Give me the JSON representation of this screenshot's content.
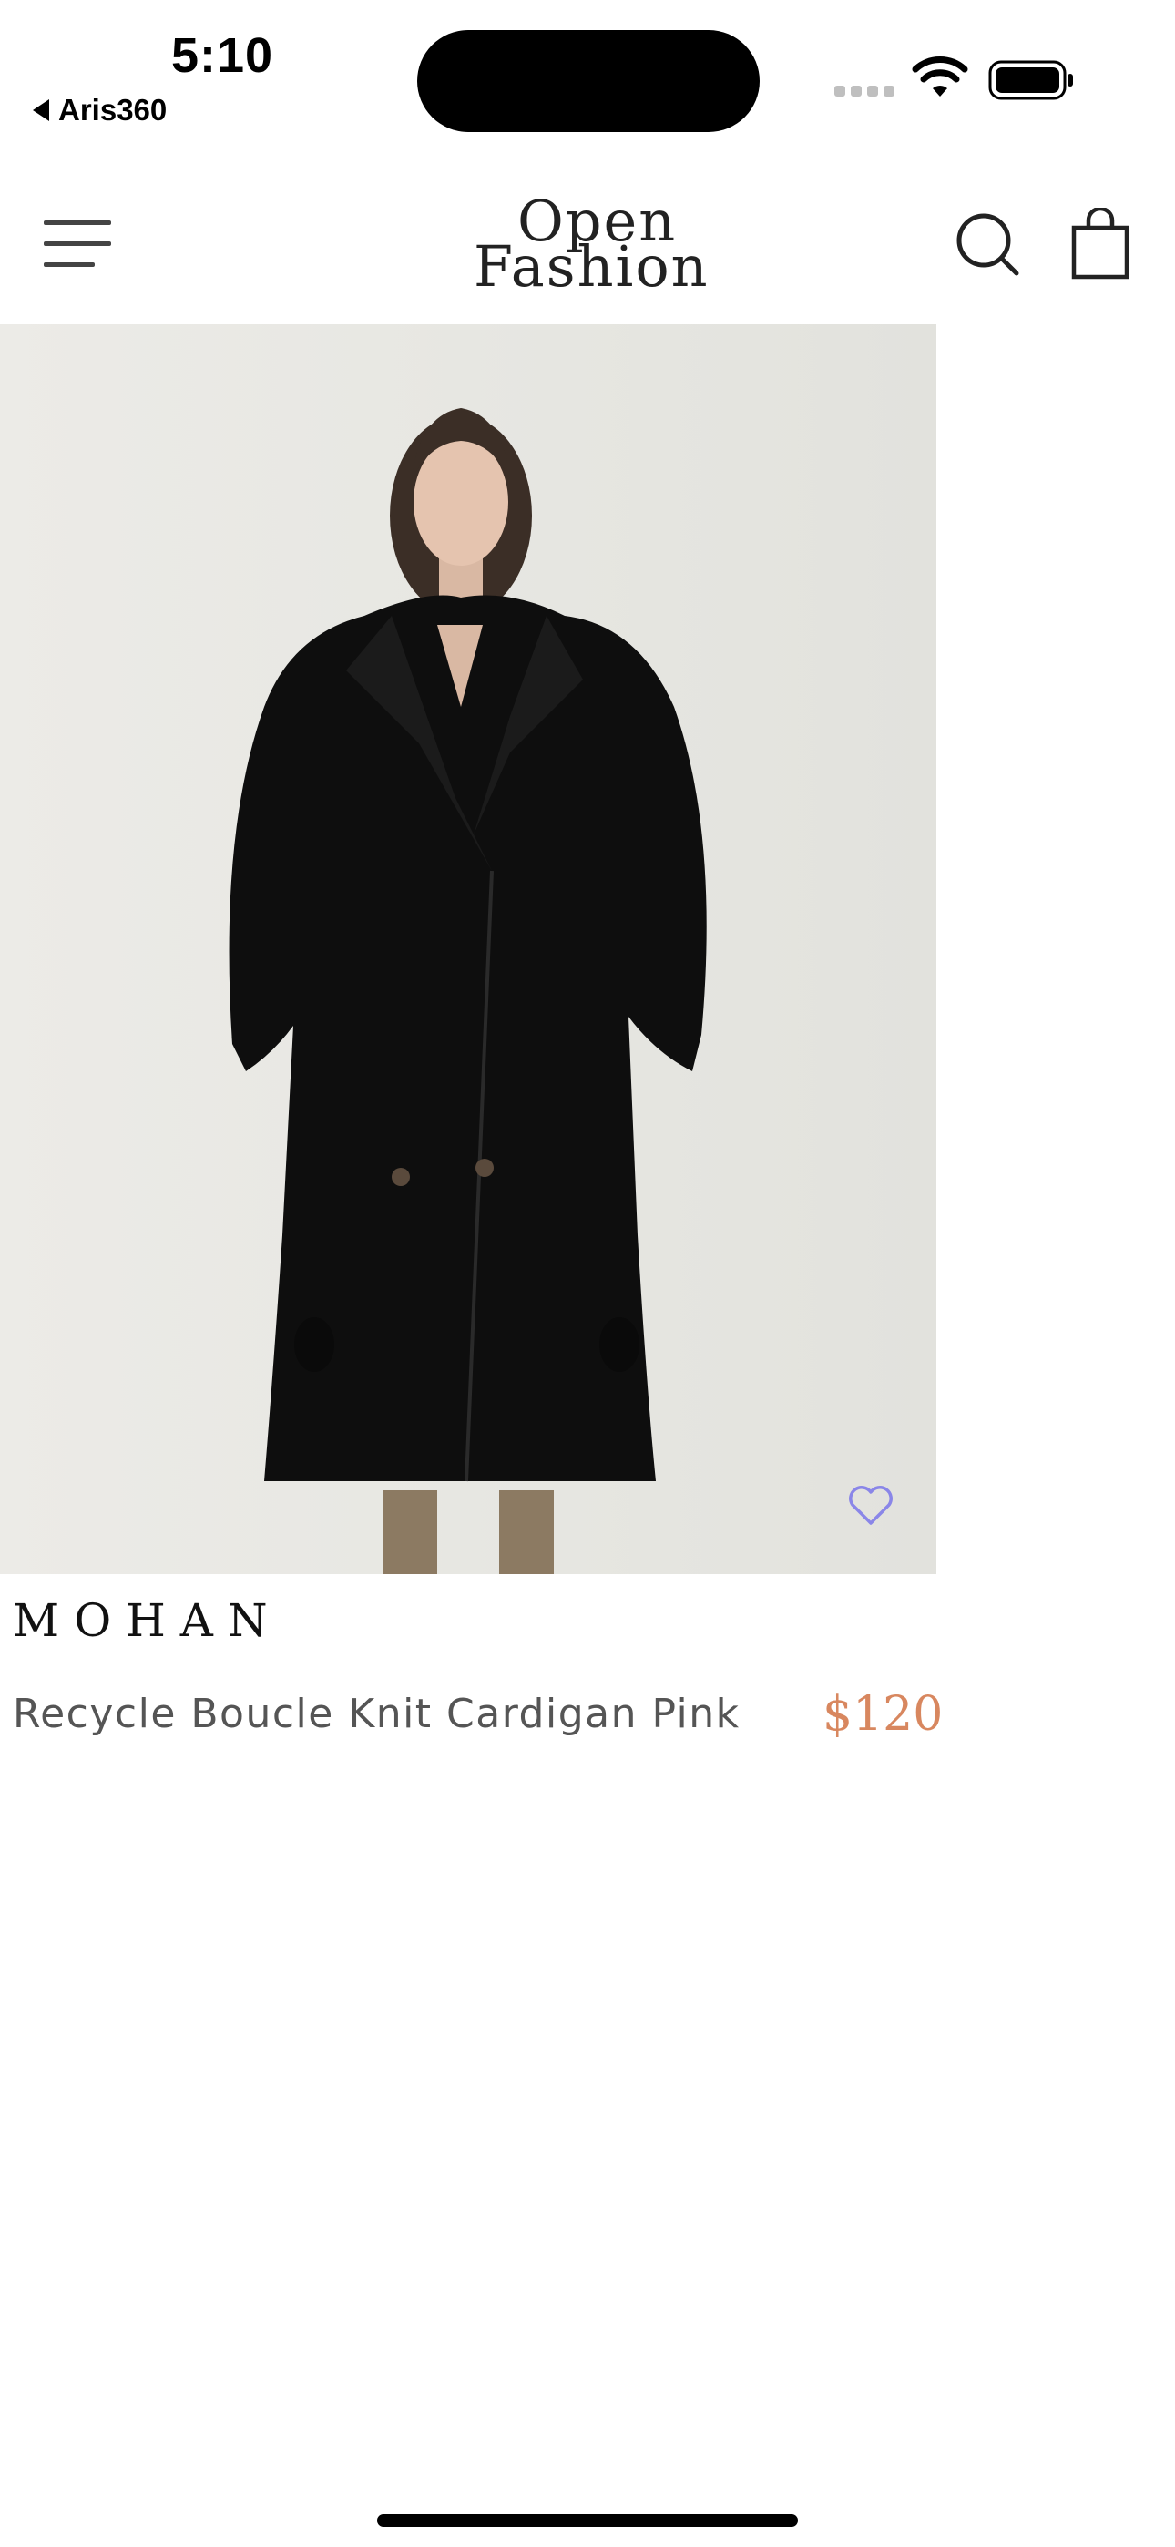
{
  "status_bar": {
    "time": "5:10",
    "back_app": "Aris360",
    "icons": [
      "cellular-signal-icon",
      "wifi-icon",
      "battery-icon"
    ]
  },
  "header": {
    "logo_line1": "Open",
    "logo_line2": "Fashion",
    "icons": [
      "hamburger-menu-icon",
      "search-icon",
      "shopping-bag-icon"
    ]
  },
  "product": {
    "brand": "MOHAN",
    "name": "Recycle Boucle Knit Cardigan Pink",
    "price": "$120",
    "image_icon": "product-photo-black-coat",
    "wishlist_icon": "heart-outline-icon"
  },
  "colors": {
    "price": "#d8875f",
    "heart": "#8a86e8",
    "text_muted": "#555555"
  }
}
